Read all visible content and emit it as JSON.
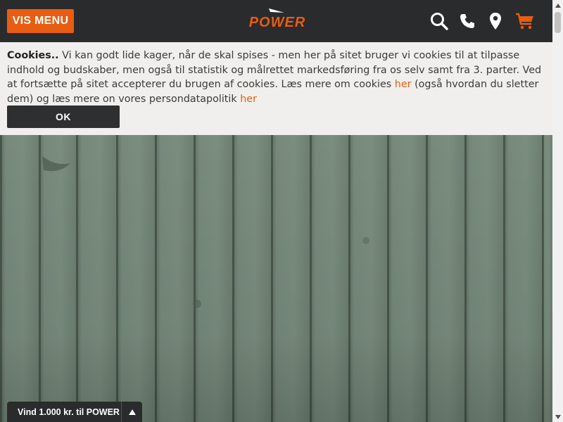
{
  "header": {
    "menu_label": "VIS MENU",
    "logo_text": "POWER",
    "icons": [
      "search-icon",
      "phone-icon",
      "location-icon",
      "cart-icon"
    ],
    "accent_color": "#e85d12",
    "bg_color": "#2a2b2d"
  },
  "cookie_banner": {
    "title": "Cookies..",
    "text_1": " Vi kan godt lide kager, når de skal spises - men her på sitet bruger vi cookies til at tilpasse indhold og budskaber, men også til statistik og målrettet markedsføring fra os selv samt fra 3. parter. Ved at fortsætte på sitet accepterer du brugen af cookies. Læs mere om cookies ",
    "link_1": "her",
    "text_2": " (også hvordan du sletter dem) og læs mere on vores persondatapolitik ",
    "link_2": "her",
    "ok_label": "OK"
  },
  "promo": {
    "label": "Vind 1.000 kr. til POWER"
  }
}
